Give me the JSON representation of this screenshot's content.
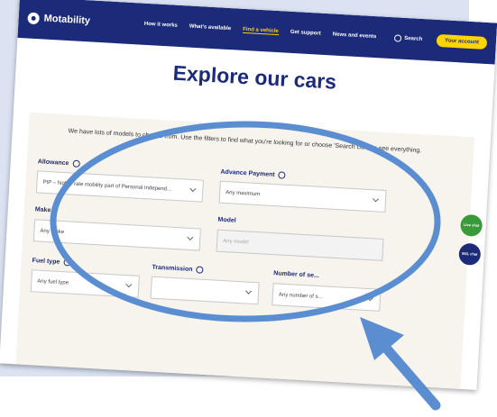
{
  "nav": {
    "brand": "Motability",
    "links": [
      "How it works",
      "What's available",
      "Find a vehicle",
      "Get support",
      "News and events"
    ],
    "search_label": "Search",
    "account_label": "Your account"
  },
  "page": {
    "title": "Explore our cars",
    "intro": "We have lots of models to choose from. Use the filters to find what you're looking for or choose 'Search cars' to see everything."
  },
  "filters": {
    "allowance": {
      "label": "Allowance",
      "value": "PIP – higher rate mobility part of Personal Independ..."
    },
    "advance_payment": {
      "label": "Advance Payment",
      "value": "Any maximum"
    },
    "make": {
      "label": "Make",
      "value": "Any make"
    },
    "model": {
      "label": "Model",
      "placeholder": "Any model"
    },
    "fuel_type": {
      "label": "Fuel type",
      "value": "Any fuel type"
    },
    "transmission": {
      "label": "Transmission",
      "value": ""
    },
    "seats": {
      "label": "Number of se...",
      "value": "Any number of s..."
    }
  },
  "side_buttons": {
    "chat": "Live chat",
    "bsl": "BSL chat"
  },
  "colors": {
    "navy": "#1c2a7a",
    "yellow": "#ffd400",
    "highlight": "#5b8ed0",
    "chat_green": "#3a9a3a"
  }
}
